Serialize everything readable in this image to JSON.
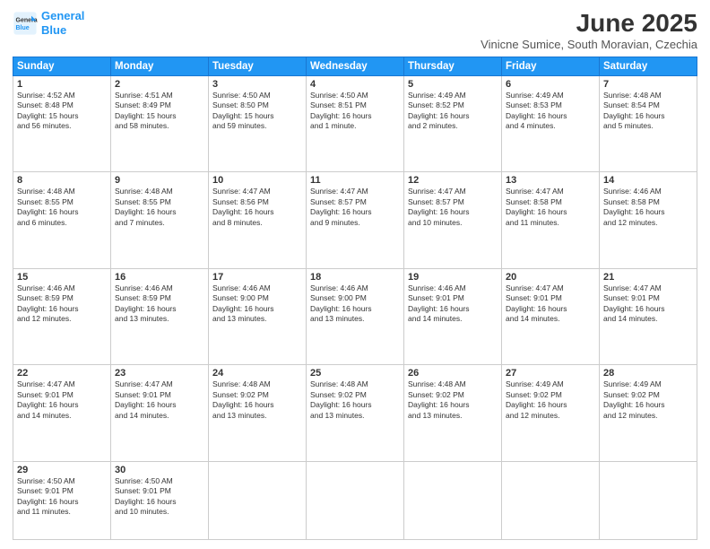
{
  "logo": {
    "line1": "General",
    "line2": "Blue"
  },
  "title": "June 2025",
  "location": "Vinicne Sumice, South Moravian, Czechia",
  "weekdays": [
    "Sunday",
    "Monday",
    "Tuesday",
    "Wednesday",
    "Thursday",
    "Friday",
    "Saturday"
  ],
  "weeks": [
    [
      {
        "day": "1",
        "info": "Sunrise: 4:52 AM\nSunset: 8:48 PM\nDaylight: 15 hours\nand 56 minutes."
      },
      {
        "day": "2",
        "info": "Sunrise: 4:51 AM\nSunset: 8:49 PM\nDaylight: 15 hours\nand 58 minutes."
      },
      {
        "day": "3",
        "info": "Sunrise: 4:50 AM\nSunset: 8:50 PM\nDaylight: 15 hours\nand 59 minutes."
      },
      {
        "day": "4",
        "info": "Sunrise: 4:50 AM\nSunset: 8:51 PM\nDaylight: 16 hours\nand 1 minute."
      },
      {
        "day": "5",
        "info": "Sunrise: 4:49 AM\nSunset: 8:52 PM\nDaylight: 16 hours\nand 2 minutes."
      },
      {
        "day": "6",
        "info": "Sunrise: 4:49 AM\nSunset: 8:53 PM\nDaylight: 16 hours\nand 4 minutes."
      },
      {
        "day": "7",
        "info": "Sunrise: 4:48 AM\nSunset: 8:54 PM\nDaylight: 16 hours\nand 5 minutes."
      }
    ],
    [
      {
        "day": "8",
        "info": "Sunrise: 4:48 AM\nSunset: 8:55 PM\nDaylight: 16 hours\nand 6 minutes."
      },
      {
        "day": "9",
        "info": "Sunrise: 4:48 AM\nSunset: 8:55 PM\nDaylight: 16 hours\nand 7 minutes."
      },
      {
        "day": "10",
        "info": "Sunrise: 4:47 AM\nSunset: 8:56 PM\nDaylight: 16 hours\nand 8 minutes."
      },
      {
        "day": "11",
        "info": "Sunrise: 4:47 AM\nSunset: 8:57 PM\nDaylight: 16 hours\nand 9 minutes."
      },
      {
        "day": "12",
        "info": "Sunrise: 4:47 AM\nSunset: 8:57 PM\nDaylight: 16 hours\nand 10 minutes."
      },
      {
        "day": "13",
        "info": "Sunrise: 4:47 AM\nSunset: 8:58 PM\nDaylight: 16 hours\nand 11 minutes."
      },
      {
        "day": "14",
        "info": "Sunrise: 4:46 AM\nSunset: 8:58 PM\nDaylight: 16 hours\nand 12 minutes."
      }
    ],
    [
      {
        "day": "15",
        "info": "Sunrise: 4:46 AM\nSunset: 8:59 PM\nDaylight: 16 hours\nand 12 minutes."
      },
      {
        "day": "16",
        "info": "Sunrise: 4:46 AM\nSunset: 8:59 PM\nDaylight: 16 hours\nand 13 minutes."
      },
      {
        "day": "17",
        "info": "Sunrise: 4:46 AM\nSunset: 9:00 PM\nDaylight: 16 hours\nand 13 minutes."
      },
      {
        "day": "18",
        "info": "Sunrise: 4:46 AM\nSunset: 9:00 PM\nDaylight: 16 hours\nand 13 minutes."
      },
      {
        "day": "19",
        "info": "Sunrise: 4:46 AM\nSunset: 9:01 PM\nDaylight: 16 hours\nand 14 minutes."
      },
      {
        "day": "20",
        "info": "Sunrise: 4:47 AM\nSunset: 9:01 PM\nDaylight: 16 hours\nand 14 minutes."
      },
      {
        "day": "21",
        "info": "Sunrise: 4:47 AM\nSunset: 9:01 PM\nDaylight: 16 hours\nand 14 minutes."
      }
    ],
    [
      {
        "day": "22",
        "info": "Sunrise: 4:47 AM\nSunset: 9:01 PM\nDaylight: 16 hours\nand 14 minutes."
      },
      {
        "day": "23",
        "info": "Sunrise: 4:47 AM\nSunset: 9:01 PM\nDaylight: 16 hours\nand 14 minutes."
      },
      {
        "day": "24",
        "info": "Sunrise: 4:48 AM\nSunset: 9:02 PM\nDaylight: 16 hours\nand 13 minutes."
      },
      {
        "day": "25",
        "info": "Sunrise: 4:48 AM\nSunset: 9:02 PM\nDaylight: 16 hours\nand 13 minutes."
      },
      {
        "day": "26",
        "info": "Sunrise: 4:48 AM\nSunset: 9:02 PM\nDaylight: 16 hours\nand 13 minutes."
      },
      {
        "day": "27",
        "info": "Sunrise: 4:49 AM\nSunset: 9:02 PM\nDaylight: 16 hours\nand 12 minutes."
      },
      {
        "day": "28",
        "info": "Sunrise: 4:49 AM\nSunset: 9:02 PM\nDaylight: 16 hours\nand 12 minutes."
      }
    ],
    [
      {
        "day": "29",
        "info": "Sunrise: 4:50 AM\nSunset: 9:01 PM\nDaylight: 16 hours\nand 11 minutes."
      },
      {
        "day": "30",
        "info": "Sunrise: 4:50 AM\nSunset: 9:01 PM\nDaylight: 16 hours\nand 10 minutes."
      },
      {
        "day": "",
        "info": ""
      },
      {
        "day": "",
        "info": ""
      },
      {
        "day": "",
        "info": ""
      },
      {
        "day": "",
        "info": ""
      },
      {
        "day": "",
        "info": ""
      }
    ]
  ]
}
